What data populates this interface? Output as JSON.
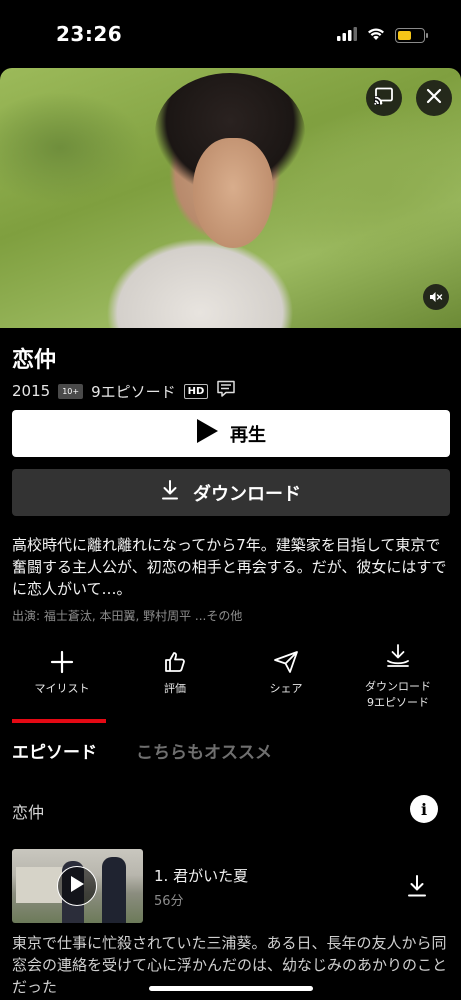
{
  "status_bar": {
    "time": "23:26",
    "battery_color": "#f5c518"
  },
  "show": {
    "title": "恋仲",
    "year": "2015",
    "rating": "10+",
    "episodes_count": "9エピソード",
    "quality": "HD",
    "subtitle_icon": "subtitles-icon"
  },
  "buttons": {
    "play_label": "再生",
    "download_label": "ダウンロード"
  },
  "synopsis": "高校時代に離れ離れになってから7年。建築家を目指して東京で奮闘する主人公が、初恋の相手と再会する。だが、彼女にはすでに恋人がいて…。",
  "cast": "出演: 福士蒼汰, 本田翼, 野村周平 ...その他",
  "actions": {
    "my_list": "マイリスト",
    "rate": "評価",
    "share": "シェア",
    "download_line1": "ダウンロード",
    "download_line2": "9エピソード"
  },
  "tabs": {
    "episodes": "エピソード",
    "more_like_this": "こちらもオススメ",
    "accent_color": "#e50914"
  },
  "season": {
    "label": "恋仲",
    "info_icon": "i"
  },
  "episode": {
    "title": "1. 君がいた夏",
    "duration": "56分",
    "description": "東京で仕事に忙殺されていた三浦葵。ある日、長年の友人から同窓会の連絡を受けて心に浮かんだのは、幼なじみのあかりのことだった"
  }
}
